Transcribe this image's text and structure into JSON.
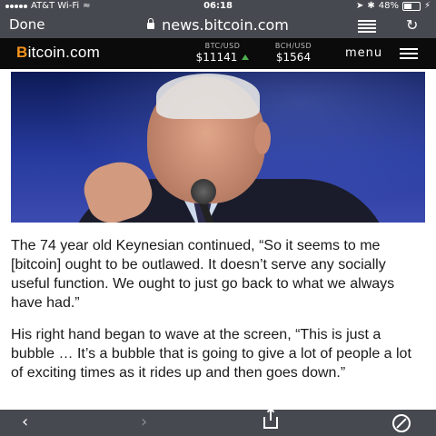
{
  "status_bar": {
    "carrier": "AT&T Wi-Fi",
    "time": "06:18",
    "battery": "48%",
    "battery_level": 0.48
  },
  "browser": {
    "done_label": "Done",
    "url": "news.bitcoin.com"
  },
  "site_header": {
    "logo_initial": "B",
    "logo_rest": "itcoin.com",
    "tickers": [
      {
        "label": "BTC/USD",
        "price": "$11141",
        "trend": "up"
      },
      {
        "label": "BCH/USD",
        "price": "$1564"
      }
    ],
    "menu_label": "menu"
  },
  "article": {
    "paragraphs": [
      "The 74 year old Keynesian continued, “So it seems to me [bitcoin] ought to be outlawed. It doesn’t serve any socially useful function. We ought to just go back to what we always have had.”",
      "His right hand began to wave at the screen, “This is just a bubble … It’s a bubble that is going to give a lot of people a lot of exciting times as it rides up and then goes down.”"
    ]
  },
  "toolbar": {
    "back": "‹",
    "forward": "›"
  },
  "colors": {
    "browser_chrome": "#46494f",
    "site_header_bg": "#0b0b0b",
    "bitcoin_orange": "#f7931a",
    "ticker_up": "#4caf50"
  }
}
